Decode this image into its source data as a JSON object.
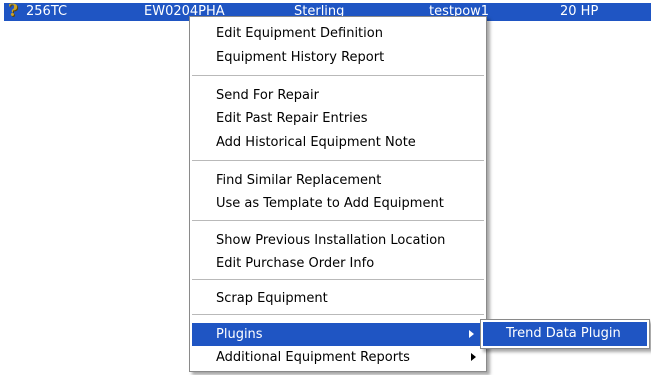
{
  "row": {
    "icon": "question-mark-icon",
    "selection_color": "#1f55c3",
    "cells": [
      "256TC",
      "EW0204PHA",
      "Sterling",
      "testpow1",
      "20 HP"
    ]
  },
  "context_menu": {
    "items": [
      {
        "label": "Edit Equipment Definition"
      },
      {
        "label": "Equipment History Report"
      },
      {
        "label": "Send For Repair"
      },
      {
        "label": "Edit Past Repair Entries"
      },
      {
        "label": "Add Historical Equipment Note"
      },
      {
        "label": "Find Similar Replacement"
      },
      {
        "label": "Use as Template to Add Equipment"
      },
      {
        "label": "Show Previous Installation Location"
      },
      {
        "label": "Edit Purchase Order Info"
      },
      {
        "label": "Scrap Equipment"
      },
      {
        "label": "Plugins",
        "has_submenu": true,
        "highlighted": true
      },
      {
        "label": "Additional Equipment Reports",
        "has_submenu": true
      }
    ]
  },
  "submenu": {
    "items": [
      {
        "label": "Trend Data Plugin",
        "highlighted": true
      }
    ]
  }
}
